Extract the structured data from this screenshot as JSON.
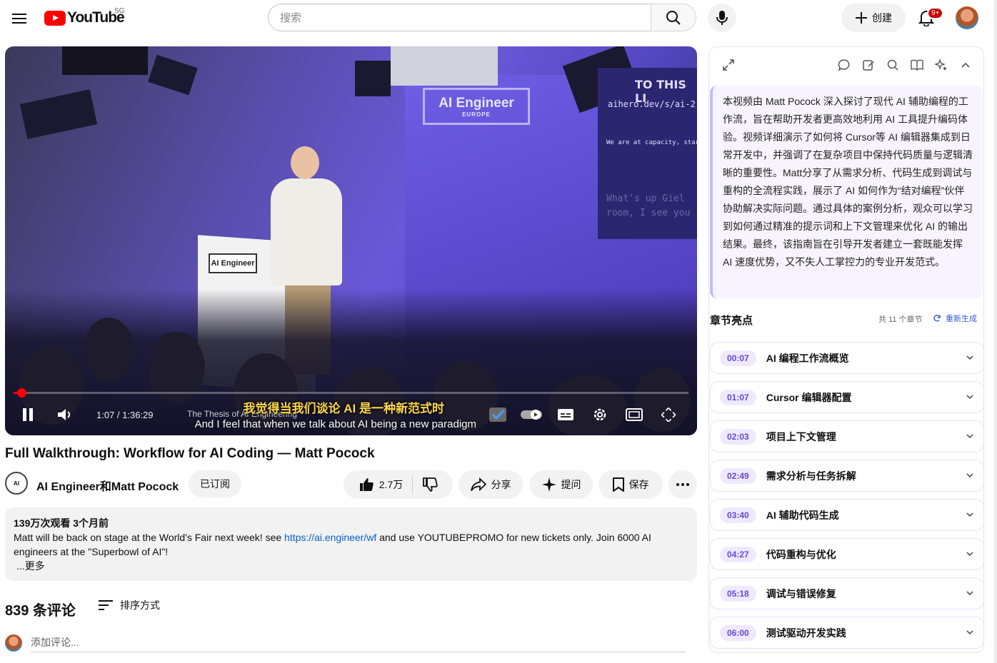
{
  "header": {
    "logo_text": "YouTube",
    "region": "SG",
    "search_placeholder": "搜索",
    "create_label": "创建",
    "notif_badge": "9+"
  },
  "player": {
    "banner_main": "AI Engineer",
    "banner_sub": "EUROPE",
    "slide_line1": "TO THIS LI",
    "slide_line2": "aihero.dev/s/ai-2",
    "slide_line3": "We are at capacity, star",
    "slide_line4": "What's up Giel",
    "slide_line5": "room, I see you",
    "podium_label": "AI Engineer",
    "time": "1:07 / 1:36:29",
    "chapter": "The Thesis of AI Engineering",
    "subtitle_zh": "我觉得当我们谈论 AI 是一种新范式时",
    "subtitle_en": "And I feel that when we talk about AI being a new paradigm",
    "progress_fraction": 0.012
  },
  "video": {
    "title": "Full Walkthrough: Workflow for AI Coding — Matt Pocock",
    "channel": "AI Engineer和Matt Pocock",
    "subscribed_label": "已订阅",
    "likes": "2.7万",
    "share_label": "分享",
    "ask_label": "提问",
    "save_label": "保存"
  },
  "description": {
    "meta": "139万次观看  3个月前",
    "text_before": "Matt will be back on stage at the World's Fair next week! see ",
    "link": "https://ai.engineer/wf",
    "text_after": " and use YOUTUBEPROMO for new tickets only. Join 6000 AI engineers at the \"Superbowl of AI\"!",
    "more": "...更多"
  },
  "comments": {
    "count": "839 条评论",
    "sort_label": "排序方式",
    "add_placeholder": "添加评论..."
  },
  "panel": {
    "summary": "本视频由 Matt Pocock 深入探讨了现代 AI 辅助编程的工作流，旨在帮助开发者更高效地利用 AI 工具提升编码体验。视频详细演示了如何将 Cursor等 AI 编辑器集成到日常开发中，并强调了在复杂项目中保持代码质量与逻辑清晰的重要性。Matt分享了从需求分析、代码生成到调试与重构的全流程实践，展示了 AI 如何作为“结对编程”伙伴协助解决实际问题。通过具体的案例分析，观众可以学习到如何通过精准的提示词和上下文管理来优化 AI 的输出结果。最终，该指南旨在引导开发者建立一套既能发挥 AI 速度优势，又不失人工掌控力的专业开发范式。",
    "chapters_title": "章节亮点",
    "chapters_count": "共 11 个章节",
    "regen_label": "重新生成",
    "chapters": [
      {
        "time": "00:07",
        "name": "AI 编程工作流概览"
      },
      {
        "time": "01:07",
        "name": "Cursor 编辑器配置"
      },
      {
        "time": "02:03",
        "name": "项目上下文管理"
      },
      {
        "time": "02:49",
        "name": "需求分析与任务拆解"
      },
      {
        "time": "03:40",
        "name": "AI 辅助代码生成"
      },
      {
        "time": "04:27",
        "name": "代码重构与优化"
      },
      {
        "time": "05:18",
        "name": "调试与错误修复"
      },
      {
        "time": "06:00",
        "name": "测试驱动开发实践"
      }
    ]
  },
  "colors": {
    "brand_red": "#ff0000",
    "accent_purple": "#6a45d8",
    "link_blue": "#065fd4",
    "subtitle_yellow": "#ffd84a"
  }
}
